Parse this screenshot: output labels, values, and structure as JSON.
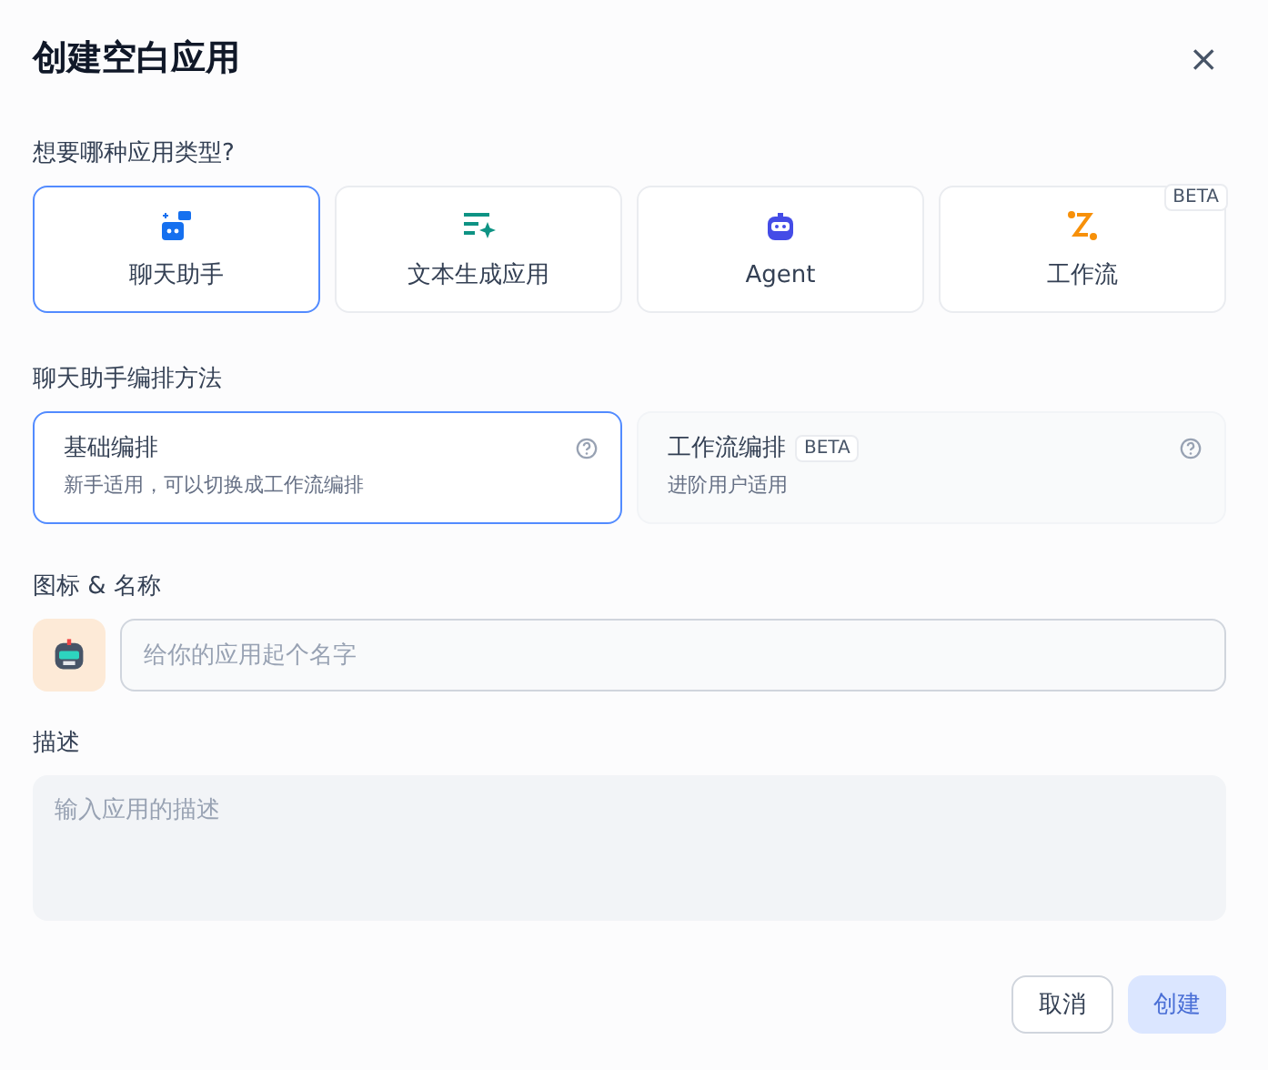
{
  "dialog": {
    "title": "创建空白应用",
    "close": "×"
  },
  "app_type": {
    "label": "想要哪种应用类型?",
    "options": [
      {
        "kind": "chat",
        "label": "聊天助手",
        "selected": true
      },
      {
        "kind": "text",
        "label": "文本生成应用",
        "selected": false
      },
      {
        "kind": "agent",
        "label": "Agent",
        "selected": false
      },
      {
        "kind": "workflow",
        "label": "工作流",
        "selected": false,
        "badge": "BETA"
      }
    ]
  },
  "method": {
    "label": "聊天助手编排方法",
    "options": [
      {
        "title": "基础编排",
        "description": "新手适用，可以切换成工作流编排",
        "selected": true
      },
      {
        "title": "工作流编排",
        "badge": "BETA",
        "description": "进阶用户适用",
        "selected": false
      }
    ]
  },
  "name": {
    "label": "图标 & 名称",
    "placeholder": "给你的应用起个名字"
  },
  "description": {
    "label": "描述",
    "placeholder": "输入应用的描述"
  },
  "buttons": [
    {
      "label": "取消",
      "kind": "secondary",
      "disabled": false
    },
    {
      "label": "创建",
      "kind": "primary",
      "disabled": true
    }
  ]
}
